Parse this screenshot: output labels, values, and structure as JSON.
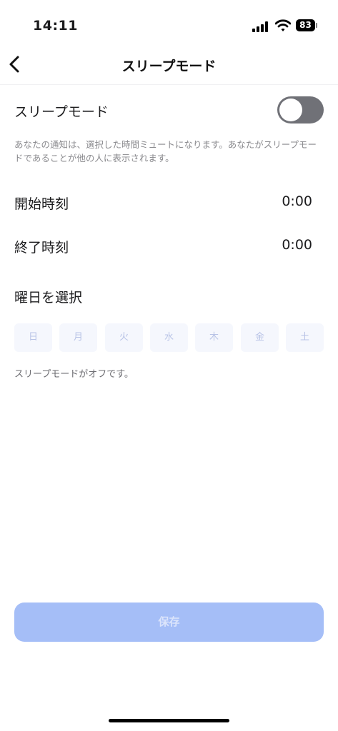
{
  "status_bar": {
    "time": "14:11",
    "battery": "83"
  },
  "nav": {
    "title": "スリープモード"
  },
  "sleep_mode": {
    "label": "スリープモード",
    "enabled": false,
    "description": "あなたの通知は、選択した時間ミュートになります。あなたがスリープモードであることが他の人に表示されます。"
  },
  "start_time": {
    "label": "開始時刻",
    "value": "0:00"
  },
  "end_time": {
    "label": "終了時刻",
    "value": "0:00"
  },
  "days": {
    "heading": "曜日を選択",
    "items": [
      "日",
      "月",
      "火",
      "水",
      "木",
      "金",
      "土"
    ]
  },
  "off_note": "スリープモードがオフです。",
  "save_label": "保存",
  "colors": {
    "accent_disabled": "#a5bef7",
    "toggle_off": "#707177",
    "day_chip_bg": "#f5f7fd",
    "day_chip_text": "#b8c3e6"
  },
  "icons": {
    "back": "chevron-left-icon",
    "signal": "cellular-signal-icon",
    "wifi": "wifi-icon",
    "battery": "battery-icon"
  }
}
